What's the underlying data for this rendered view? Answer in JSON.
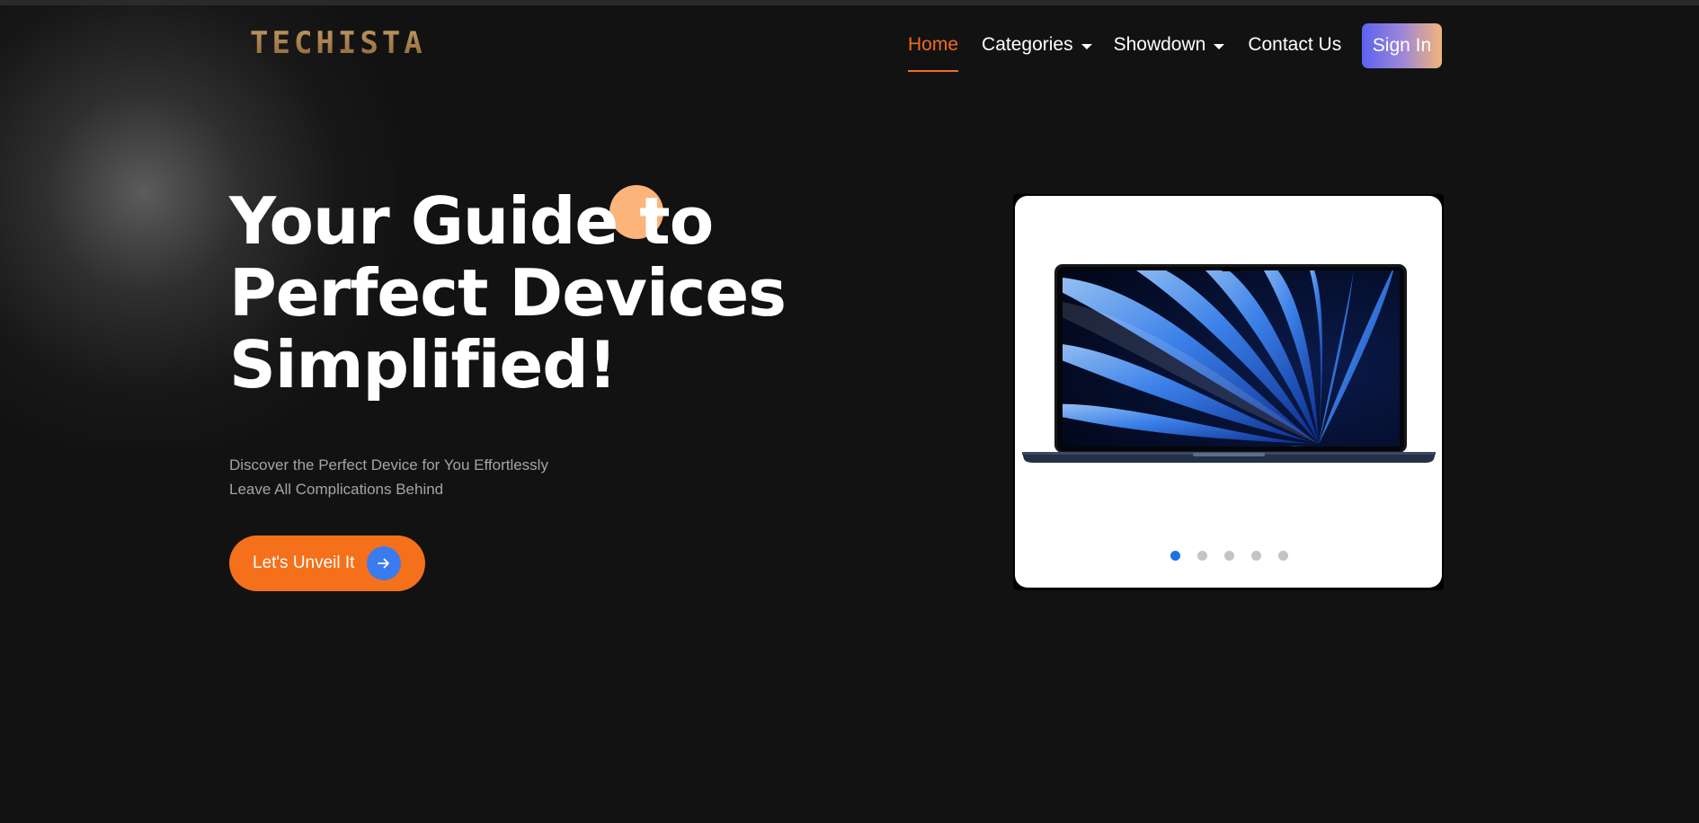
{
  "header": {
    "logo_text": "TECHISTA",
    "nav": [
      {
        "label": "Home",
        "active": true,
        "has_dropdown": false
      },
      {
        "label": "Categories",
        "active": false,
        "has_dropdown": true
      },
      {
        "label": "Showdown",
        "active": false,
        "has_dropdown": true
      },
      {
        "label": "Contact Us",
        "active": false,
        "has_dropdown": false
      }
    ],
    "sign_in_label": "Sign In"
  },
  "hero": {
    "title_lines": [
      "Your Guide to",
      "Perfect Devices",
      "Simplified!"
    ],
    "subtitle_lines": [
      "Discover the Perfect Device for You Effortlessly",
      "Leave All Complications Behind"
    ],
    "cta_label": "Let's Unveil It",
    "cta_icon": "arrow-right-icon"
  },
  "carousel": {
    "current_slide_image": "laptop-image",
    "slide_count": 5,
    "active_index": 0
  },
  "colors": {
    "background": "#121212",
    "accent_orange": "#f5701a",
    "nav_active": "#f26b21",
    "cta_arrow_bg": "#3a7cf0",
    "dot_active": "#1a73e8",
    "dot_inactive": "#c4c4c4",
    "sign_in_gradient": [
      "#5b63f0",
      "#f3b47a"
    ],
    "decor_circle": "#fcb47a"
  }
}
